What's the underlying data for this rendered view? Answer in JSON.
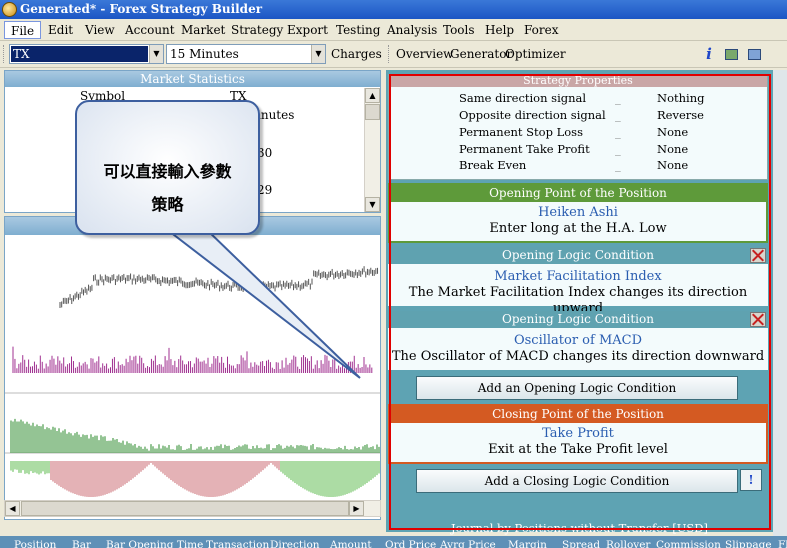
{
  "window": {
    "title": "Generated* - Forex Strategy Builder"
  },
  "menu": [
    "File",
    "Edit",
    "View",
    "Account",
    "Market",
    "Strategy",
    "Export",
    "Testing",
    "Analysis",
    "Tools",
    "Help",
    "Forex"
  ],
  "toolbar": {
    "symbol": "TX",
    "timeframe": "15 Minutes",
    "charges": "Charges",
    "overview": "Overview",
    "generator": "Generator",
    "optimizer": "Optimizer"
  },
  "market_statistics": {
    "title": "Market Statistics",
    "symbol_label": "Symbol",
    "symbol_value": "TX",
    "partial_values": [
      "inutes",
      "30",
      "29"
    ]
  },
  "callout": {
    "line1": "可以直接輸入參數",
    "line2": "策略"
  },
  "strategy_properties": {
    "title": "Strategy Properties",
    "rows": [
      {
        "key": "Same direction signal",
        "dash": "_",
        "value": "Nothing"
      },
      {
        "key": "Opposite direction signal",
        "dash": "_",
        "value": "Reverse"
      },
      {
        "key": "Permanent Stop Loss",
        "dash": "_",
        "value": "None"
      },
      {
        "key": "Permanent Take Profit",
        "dash": "_",
        "value": "None"
      },
      {
        "key": "Break Even",
        "dash": "_",
        "value": "None"
      }
    ]
  },
  "opening_point": {
    "title": "Opening Point of the Position",
    "name": "Heiken Ashi",
    "desc": "Enter long at the H.A. Low"
  },
  "logic1": {
    "title": "Opening Logic Condition",
    "name": "Market Facilitation Index",
    "desc": "The Market Facilitation Index changes its direction upward"
  },
  "logic2": {
    "title": "Opening Logic Condition",
    "name": "Oscillator of MACD",
    "desc": "The Oscillator of MACD changes its direction downward"
  },
  "add_opening": "Add an Opening Logic Condition",
  "closing_point": {
    "title": "Closing Point of the Position",
    "name": "Take Profit",
    "desc": "Exit at the Take Profit level"
  },
  "add_closing": "Add a Closing Logic Condition",
  "add_closing_extra": "!",
  "journal": "Journal by Positions without Transfer [USD]",
  "bottom_columns": [
    "Position",
    "Bar",
    "Bar Opening Time",
    "Transaction",
    "Direction",
    "Amount",
    "Ord Price",
    "Avrg Price",
    "Margin",
    "Spread",
    "Rollover",
    "Commission",
    "Slippage",
    "Fl"
  ],
  "colors": {
    "panel": "#5ea3b3",
    "opening": "#5e9a3a",
    "logic": "#5fa2b0",
    "closing": "#d45a22",
    "highlight": "#e00000"
  }
}
